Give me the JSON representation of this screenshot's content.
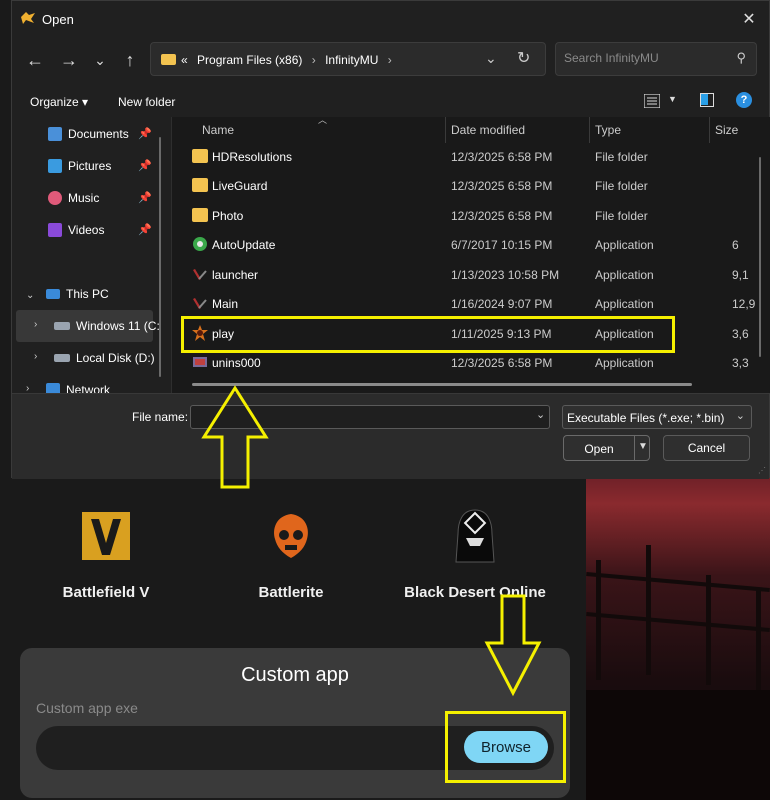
{
  "dialog": {
    "title": "Open",
    "close_glyph": "✕",
    "nav": {
      "back": "←",
      "forward": "→",
      "recent": "⌄",
      "up": "↑"
    },
    "address": {
      "overflow": "«",
      "segments": [
        "Program Files (x86)",
        "InfinityMU"
      ],
      "separator": "›"
    },
    "search": {
      "placeholder": "Search InfinityMU"
    },
    "toolbar": {
      "organize": "Organize ▾",
      "new_folder": "New folder",
      "help": "?"
    },
    "nav_pane": {
      "items": [
        {
          "label": "Documents",
          "icon": "documents-icon",
          "pinned": true
        },
        {
          "label": "Pictures",
          "icon": "pictures-icon",
          "pinned": true
        },
        {
          "label": "Music",
          "icon": "music-icon",
          "pinned": true
        },
        {
          "label": "Videos",
          "icon": "videos-icon",
          "pinned": true
        },
        {
          "label": "This PC",
          "icon": "computer-icon",
          "expanded": true
        },
        {
          "label": "Windows 11 (C:",
          "icon": "drive-icon",
          "selected": true
        },
        {
          "label": "Local Disk (D:)",
          "icon": "drive-icon"
        },
        {
          "label": "Network",
          "icon": "network-icon"
        }
      ]
    },
    "columns": [
      "Name",
      "Date modified",
      "Type",
      "Size"
    ],
    "files": [
      {
        "name": "HDResolutions",
        "date": "12/3/2025 6:58 PM",
        "type": "File folder",
        "size": "",
        "icon": "folder-icon"
      },
      {
        "name": "LiveGuard",
        "date": "12/3/2025 6:58 PM",
        "type": "File folder",
        "size": "",
        "icon": "folder-icon"
      },
      {
        "name": "Photo",
        "date": "12/3/2025 6:58 PM",
        "type": "File folder",
        "size": "",
        "icon": "folder-icon"
      },
      {
        "name": "AutoUpdate",
        "date": "6/7/2017 10:15 PM",
        "type": "Application",
        "size": "6",
        "icon": "autoupdate-icon"
      },
      {
        "name": "launcher",
        "date": "1/13/2023 10:58 PM",
        "type": "Application",
        "size": "9,1",
        "icon": "launcher-icon"
      },
      {
        "name": "Main",
        "date": "1/16/2024 9:07 PM",
        "type": "Application",
        "size": "12,9",
        "icon": "main-icon"
      },
      {
        "name": "play",
        "date": "1/11/2025 9:13 PM",
        "type": "Application",
        "size": "3,6",
        "icon": "play-app-icon"
      },
      {
        "name": "unins000",
        "date": "12/3/2025 6:58 PM",
        "type": "Application",
        "size": "3,3",
        "icon": "uninstall-icon"
      }
    ],
    "file_name_label": "File name:",
    "file_name_value": "",
    "file_type": "Executable Files (*.exe; *.bin)",
    "open": "Open",
    "cancel": "Cancel"
  },
  "background_app": {
    "games": [
      {
        "name": "Battlefield V",
        "icon": "battlefield-v-logo"
      },
      {
        "name": "Battlerite",
        "icon": "battlerite-logo"
      },
      {
        "name": "Black Desert Online",
        "icon": "black-desert-logo"
      }
    ],
    "custom_app": {
      "title": "Custom app",
      "exe_label": "Custom app exe",
      "exe_value": "",
      "browse": "Browse"
    }
  },
  "annotations": {
    "color": "#f5f000"
  }
}
